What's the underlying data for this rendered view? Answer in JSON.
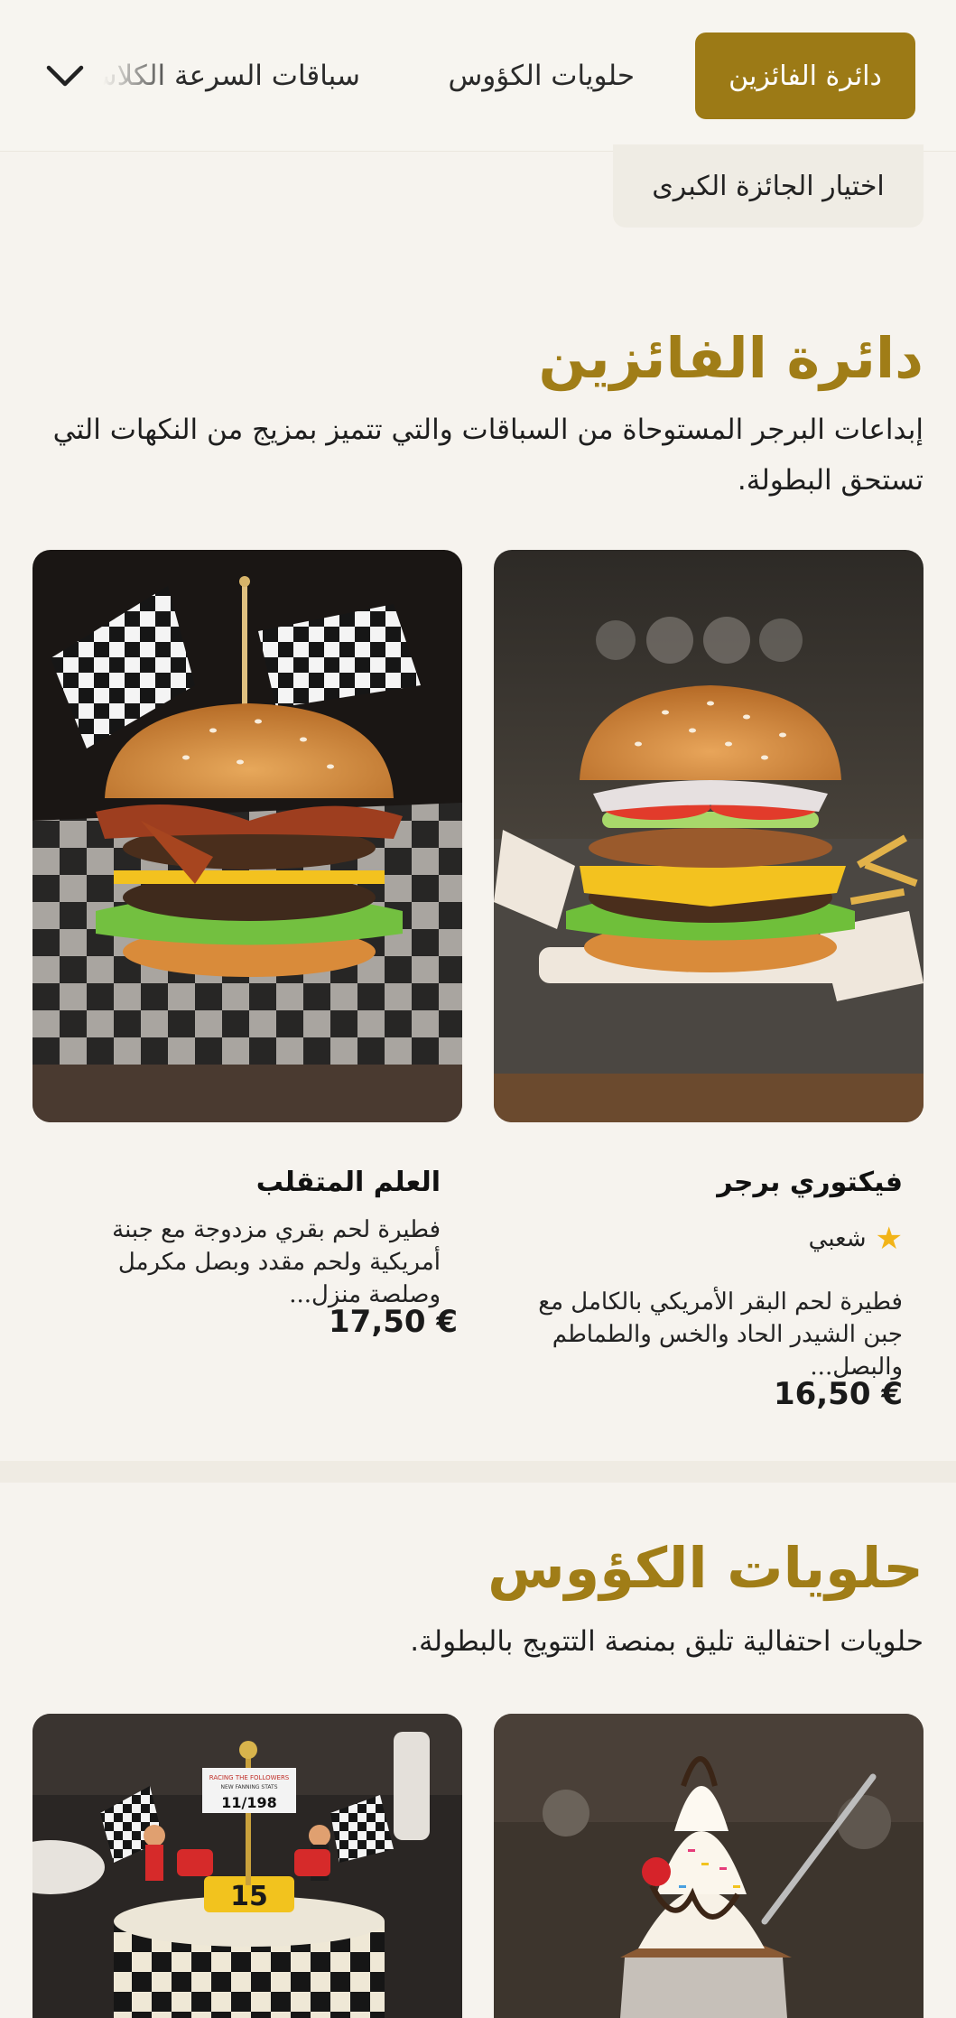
{
  "nav": {
    "active_label": "دائرة الفائزين",
    "cups_label": "حلويات الكؤوس",
    "classic_label": "سباقات السرعة الكلاسيكية",
    "chevron_icon": "chevron-down-icon"
  },
  "subtab": {
    "label": "اختيار الجائزة الكبرى"
  },
  "winners": {
    "title": "دائرة الفائزين",
    "description": "إبداعات البرجر المستوحاة من السباقات والتي تتميز بمزيج من النكهات التي تستحق البطولة.",
    "items": [
      {
        "name": "فيكتوري برجر",
        "badge": "شعبي",
        "badge_icon": "star-icon",
        "description": "فطيرة لحم البقر الأمريكي بالكامل مع جبن الشيدر الحاد والخس والطماطم والبصل...",
        "price": "16,50 €"
      },
      {
        "name": "العلم المتقلب",
        "description": "فطيرة لحم بقري مزدوجة مع جبنة أمريكية ولحم مقدد وبصل مكرمل وصلصة منزل...",
        "price": "17,50 €"
      }
    ]
  },
  "cups": {
    "title": "حلويات الكؤوس",
    "description": "حلويات احتفالية تليق بمنصة التتويج بالبطولة.",
    "cake_sign": {
      "line1": "RACING THE FOLLOWERS",
      "line2": "NEW FANNING STATS",
      "number": "11/198"
    },
    "cake_topper": "15"
  },
  "colors": {
    "accent": "#9c7a16",
    "title": "#a07d17",
    "background": "#f6f3ee",
    "star": "#f2b418"
  }
}
